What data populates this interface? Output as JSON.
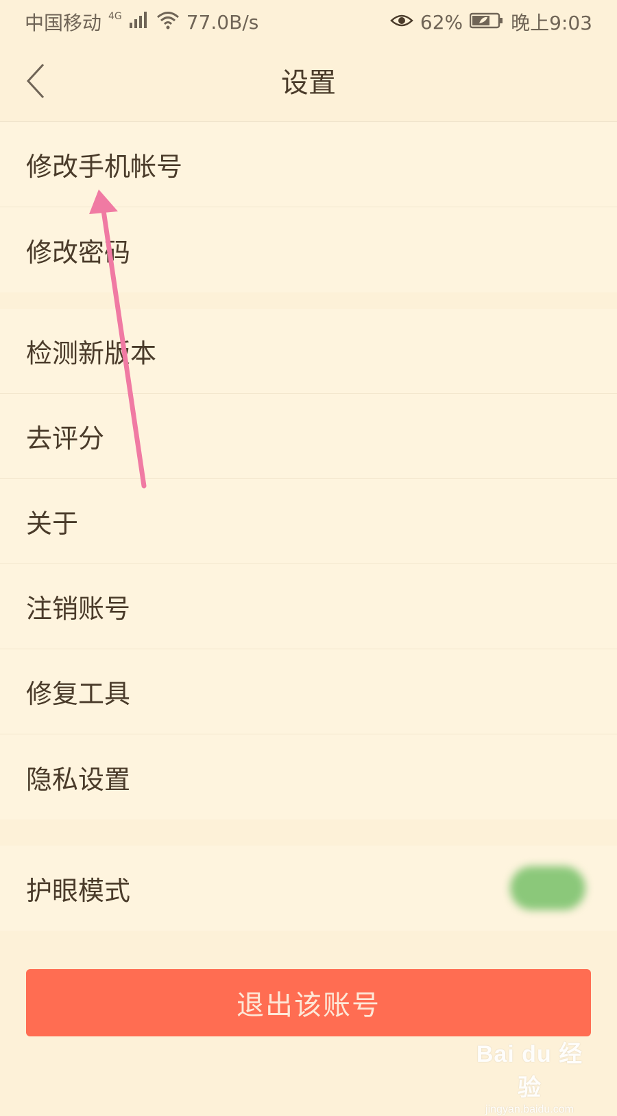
{
  "status_bar": {
    "carrier": "中国移动",
    "network": "4G",
    "speed": "77.0B/s",
    "battery": "62%",
    "time": "晚上9:03",
    "icons": [
      "signal-icon",
      "wifi-icon",
      "eye-care-icon",
      "battery-icon"
    ]
  },
  "nav": {
    "title": "设置",
    "back_icon": "chevron-left-icon"
  },
  "groups": [
    {
      "items": [
        "修改手机帐号",
        "修改密码"
      ]
    },
    {
      "items": [
        "检测新版本",
        "去评分",
        "关于",
        "注销账号",
        "修复工具",
        "隐私设置"
      ]
    },
    {
      "items": [
        "护眼模式"
      ],
      "toggle": {
        "label": "护眼模式",
        "on": true,
        "color": "#8bc87a"
      }
    }
  ],
  "logout": {
    "label": "退出该账号",
    "color": "#ff6d52"
  },
  "annotation": {
    "type": "arrow",
    "color": "#f07aa3",
    "points_to": "修改手机帐号"
  },
  "watermark": {
    "logo": "Bai du 经验",
    "url": "jingyan.baidu.com"
  },
  "colors": {
    "background": "#fdf1d8",
    "text": "#4a3b2a"
  }
}
